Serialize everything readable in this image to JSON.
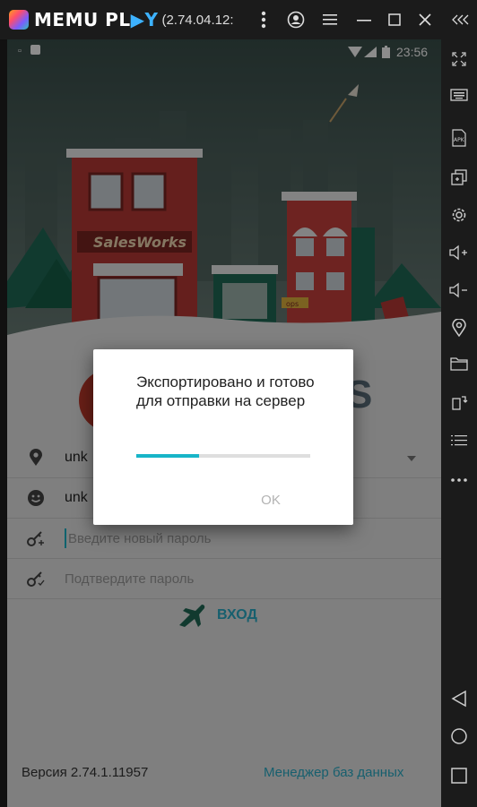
{
  "emulator": {
    "brand": "MEMU PL",
    "brand_play": "▶Y",
    "version": "(2.74.04.12:",
    "more_icon": "kebab-icon",
    "account_icon": "account-icon",
    "menu_icon": "menu-icon",
    "minimize_icon": "minimize-icon",
    "maximize_icon": "maximize-icon",
    "close_icon": "close-icon",
    "collapse_icon": "collapse-icon"
  },
  "toolbar": [
    "fullscreen-icon",
    "keyboard-icon",
    "apk-icon",
    "multi-window-icon",
    "settings-icon",
    "volume-up-icon",
    "volume-down-icon",
    "location-icon",
    "folder-icon",
    "rotate-icon",
    "more-list-icon",
    "more-icon",
    "back-icon",
    "home-icon",
    "recent-icon"
  ],
  "statusbar": {
    "time": "23:56"
  },
  "hero": {
    "sign": "SalesWorks",
    "kiosk": "ops"
  },
  "login": {
    "fields": [
      {
        "kind": "location",
        "value": "unk",
        "icon": "location-pin-icon"
      },
      {
        "kind": "user",
        "value": "unk",
        "icon": "user-face-icon"
      },
      {
        "kind": "new-password",
        "placeholder": "Введите новый пароль",
        "icon": "key-plus-icon"
      },
      {
        "kind": "confirm-password",
        "placeholder": "Подтвердите пароль",
        "icon": "key-check-icon"
      }
    ],
    "enter_label": "ВХОД",
    "brand_partial": "S"
  },
  "dialog": {
    "message": "Экспортировано и готово для отправки на сервер",
    "progress_percent": 36,
    "ok_label": "OK"
  },
  "footer": {
    "version": "Версия 2.74.1.11957",
    "db_manager": "Менеджер баз данных"
  },
  "colors": {
    "accent": "#18b5c8",
    "link": "#2aaec9",
    "sky_top": "#3a4f4b",
    "sky_bottom": "#6e817b"
  }
}
